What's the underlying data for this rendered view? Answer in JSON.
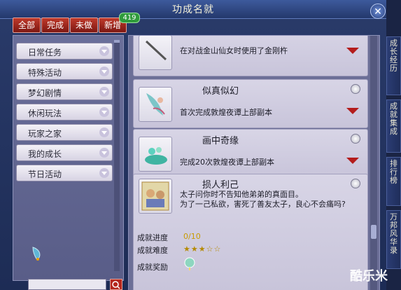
{
  "window": {
    "title": "功成名就",
    "close_icon": "close-icon"
  },
  "tabs": [
    {
      "label": "全部"
    },
    {
      "label": "完成"
    },
    {
      "label": "未做"
    },
    {
      "label": "新增"
    }
  ],
  "new_count": "419",
  "sidebar": {
    "items": [
      {
        "label": "日常任务"
      },
      {
        "label": "特殊活动"
      },
      {
        "label": "梦幻剧情"
      },
      {
        "label": "休闲玩法"
      },
      {
        "label": "玩家之家"
      },
      {
        "label": "我的成长"
      },
      {
        "label": "节日活动"
      }
    ],
    "search_placeholder": ""
  },
  "achievements": [
    {
      "name": "",
      "desc": "在对战金山仙女时使用了金刚杵",
      "icon": "staff-icon"
    },
    {
      "name": "似真似幻",
      "desc": "首次完成敦煌夜谭上部副本",
      "icon": "fairy-icon"
    },
    {
      "name": "画中奇缘",
      "desc": "完成20次敦煌夜谭上部副本",
      "icon": "jade-plant-icon"
    }
  ],
  "detail": {
    "name": "损人利己",
    "story_line1": "太子问你时不告知他弟弟的真面目。",
    "story_line2": "为了一己私欲，害死了善友太子，良心不会痛吗?",
    "progress_label": "成就进度",
    "progress_value": "0/10",
    "difficulty_label": "成就难度",
    "difficulty_stars": "★★★☆☆",
    "reward_label": "成就奖励"
  },
  "rightbar": {
    "items": [
      {
        "label": "成长经历"
      },
      {
        "label": "成就集成"
      },
      {
        "label": "排行榜"
      },
      {
        "label": "万邦风华录"
      }
    ]
  },
  "watermark": "酷乐米"
}
